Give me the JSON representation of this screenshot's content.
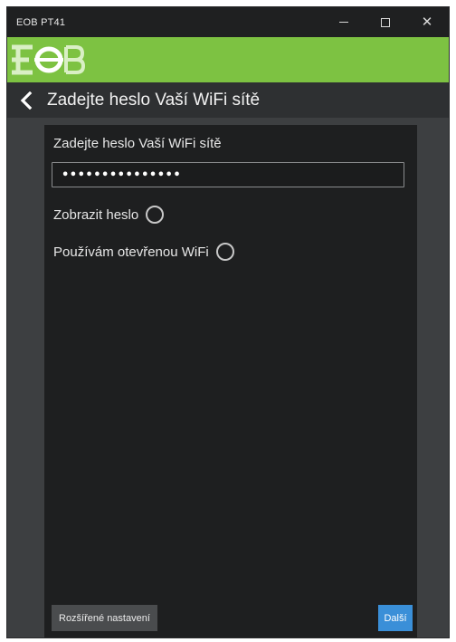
{
  "window": {
    "title": "EOB PT41",
    "close_glyph": "✕"
  },
  "brand": {
    "logo_name": "eob-logo",
    "color": "#7dc242"
  },
  "nav": {
    "title": "Zadejte heslo Vaší WiFi sítě"
  },
  "form": {
    "password_label": "Zadejte heslo Vaší WiFi sítě",
    "password_value": "•••••••••••••••",
    "show_password_label": "Zobrazit heslo",
    "open_wifi_label": "Používám otevřenou WiFi"
  },
  "footer": {
    "advanced_label": "Rozšířené nastavení",
    "next_label": "Další"
  }
}
